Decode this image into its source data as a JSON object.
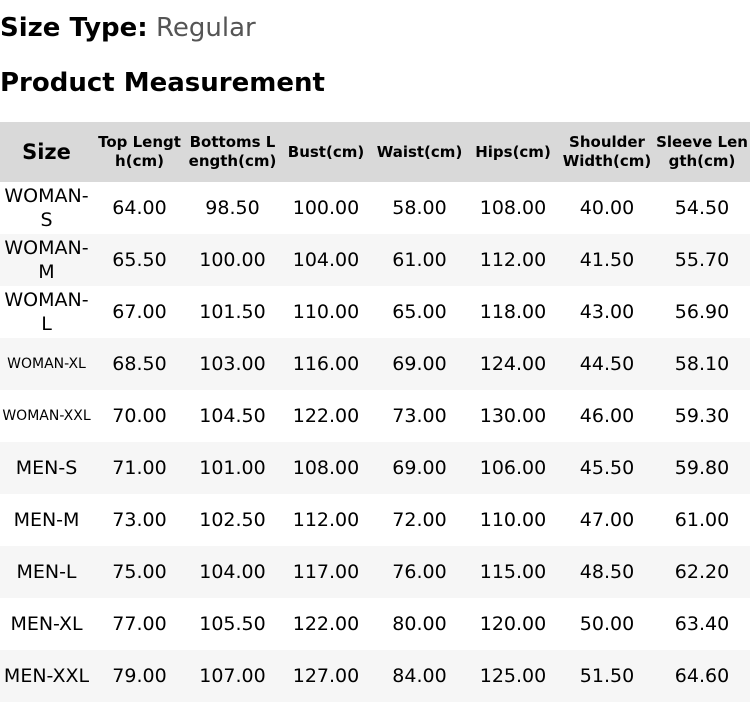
{
  "size_type": {
    "label": "Size Type:",
    "value": "Regular"
  },
  "section_title": "Product Measurement",
  "table": {
    "headers": [
      "Size",
      "Top Length(cm)",
      "Bottoms Length(cm)",
      "Bust(cm)",
      "Waist(cm)",
      "Hips(cm)",
      "Shoulder Width(cm)",
      "Sleeve Length(cm)"
    ],
    "rows": [
      [
        "WOMAN-S",
        "64.00",
        "98.50",
        "100.00",
        "58.00",
        "108.00",
        "40.00",
        "54.50"
      ],
      [
        "WOMAN-M",
        "65.50",
        "100.00",
        "104.00",
        "61.00",
        "112.00",
        "41.50",
        "55.70"
      ],
      [
        "WOMAN-L",
        "67.00",
        "101.50",
        "110.00",
        "65.00",
        "118.00",
        "43.00",
        "56.90"
      ],
      [
        "WOMAN-XL",
        "68.50",
        "103.00",
        "116.00",
        "69.00",
        "124.00",
        "44.50",
        "58.10"
      ],
      [
        "WOMAN-XXL",
        "70.00",
        "104.50",
        "122.00",
        "73.00",
        "130.00",
        "46.00",
        "59.30"
      ],
      [
        "MEN-S",
        "71.00",
        "101.00",
        "108.00",
        "69.00",
        "106.00",
        "45.50",
        "59.80"
      ],
      [
        "MEN-M",
        "73.00",
        "102.50",
        "112.00",
        "72.00",
        "110.00",
        "47.00",
        "61.00"
      ],
      [
        "MEN-L",
        "75.00",
        "104.00",
        "117.00",
        "76.00",
        "115.00",
        "48.50",
        "62.20"
      ],
      [
        "MEN-XL",
        "77.00",
        "105.50",
        "122.00",
        "80.00",
        "120.00",
        "50.00",
        "63.40"
      ],
      [
        "MEN-XXL",
        "79.00",
        "107.00",
        "127.00",
        "84.00",
        "125.00",
        "51.50",
        "64.60"
      ]
    ]
  }
}
